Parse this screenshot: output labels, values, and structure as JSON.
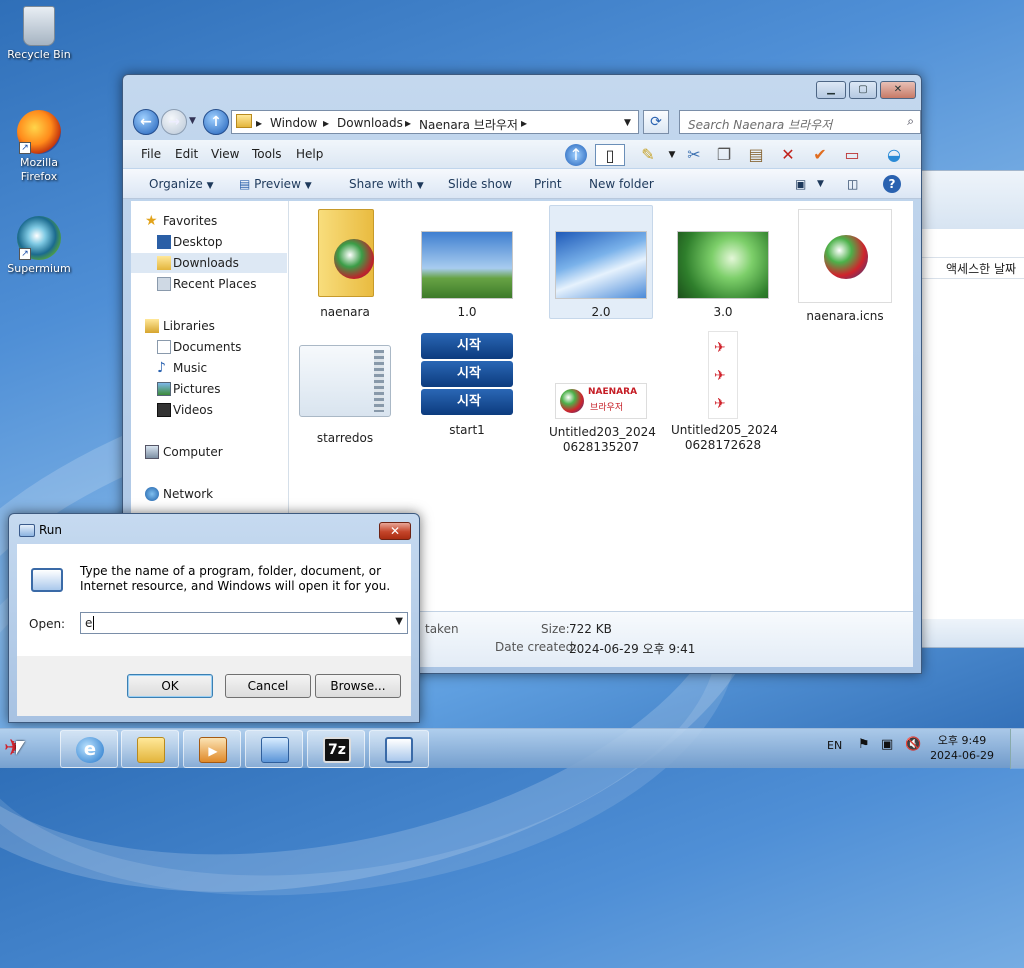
{
  "desktop": {
    "icons": [
      {
        "label": "Recycle Bin"
      },
      {
        "label": "Mozilla Firefox"
      },
      {
        "label": "Supermium"
      }
    ]
  },
  "explorer": {
    "breadcrumbs": [
      "Window",
      "Downloads",
      "Naenara 브라우저"
    ],
    "search_placeholder": "Search Naenara 브라우저",
    "menu": [
      "File",
      "Edit",
      "View",
      "Tools",
      "Help"
    ],
    "commands": {
      "organize": "Organize",
      "preview": "Preview",
      "share": "Share with",
      "slideshow": "Slide show",
      "print": "Print",
      "newfolder": "New folder"
    },
    "nav": {
      "favorites": "Favorites",
      "desktop": "Desktop",
      "downloads": "Downloads",
      "recent": "Recent Places",
      "libraries": "Libraries",
      "documents": "Documents",
      "music": "Music",
      "pictures": "Pictures",
      "videos": "Videos",
      "computer": "Computer",
      "network": "Network"
    },
    "items": [
      {
        "label": "naenara"
      },
      {
        "label": "1.0"
      },
      {
        "label": "2.0"
      },
      {
        "label": "3.0"
      },
      {
        "label": "naenara.icns"
      },
      {
        "label": "starredos"
      },
      {
        "label": "start1"
      },
      {
        "label": "Untitled203_2024 0628135207"
      },
      {
        "label": "Untitled205_2024 0628172628"
      }
    ],
    "start_tile_text": "시작",
    "naenara_logo_text": "NAENARA",
    "naenara_logo_sub": "브라우저",
    "details": {
      "taken_label": "taken",
      "size_label": "Size:",
      "size_value": "722 KB",
      "created_label": "Date created:",
      "created_value": "2024-06-29 오후 9:41"
    }
  },
  "background_window": {
    "column_header": "액세스한 날짜"
  },
  "run_dialog": {
    "title": "Run",
    "message": "Type the name of a program, folder, document, or Internet resource, and Windows will open it for you.",
    "open_label": "Open:",
    "open_value": "e",
    "ok": "OK",
    "cancel": "Cancel",
    "browse": "Browse..."
  },
  "taskbar": {
    "language": "EN",
    "time": "오후 9:49",
    "date": "2024-06-29"
  }
}
